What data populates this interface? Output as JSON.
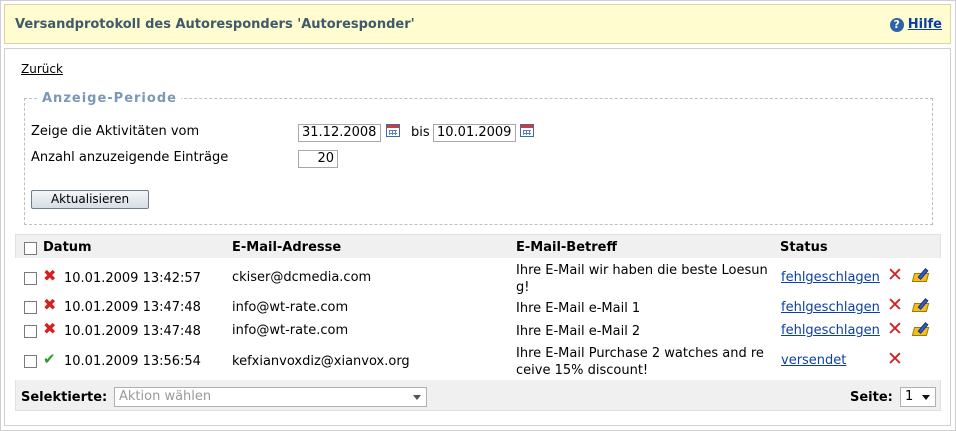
{
  "header": {
    "title": "Versandprotokoll des Autoresponders 'Autoresponder'",
    "help_label": "Hilfe",
    "help_icon": "?"
  },
  "back_link": "Zurück",
  "period": {
    "legend": "Anzeige-Periode",
    "from_label": "Zeige die Aktivitäten vom",
    "from_value": "31.12.2008",
    "bis_label": "bis",
    "to_value": "10.01.2009",
    "count_label": "Anzahl anzuzeigende Einträge",
    "count_value": "20",
    "update_button": "Aktualisieren"
  },
  "table": {
    "columns": {
      "datum": "Datum",
      "email": "E-Mail-Adresse",
      "subject": "E-Mail-Betreff",
      "status": "Status"
    },
    "rows": [
      {
        "result": "failed",
        "date": "10.01.2009 13:42:57",
        "email": "ckiser@dcmedia.com",
        "subject": "Ihre E-Mail wir haben die beste Loesung!",
        "status": "fehlgeschlagen",
        "editable": true
      },
      {
        "result": "failed",
        "date": "10.01.2009 13:47:48",
        "email": "info@wt-rate.com",
        "subject": "Ihre E-Mail e-Mail 1",
        "status": "fehlgeschlagen",
        "editable": true
      },
      {
        "result": "failed",
        "date": "10.01.2009 13:47:48",
        "email": "info@wt-rate.com",
        "subject": "Ihre E-Mail e-Mail 2",
        "status": "fehlgeschlagen",
        "editable": true
      },
      {
        "result": "sent",
        "date": "10.01.2009 13:56:54",
        "email": "kefxianvoxdiz@xianvox.org",
        "subject": "Ihre E-Mail Purchase 2 watches and receive 15% discount!",
        "status": "versendet",
        "editable": false
      }
    ]
  },
  "footer": {
    "selected_label": "Selektierte:",
    "action_placeholder": "Aktion wählen",
    "page_label": "Seite:",
    "page_value": "1"
  },
  "colors": {
    "header_bg": "#fffccf",
    "link": "#0a3fa8",
    "legend": "#7b98b6",
    "fail": "#d42020",
    "success": "#2e9a2e"
  }
}
